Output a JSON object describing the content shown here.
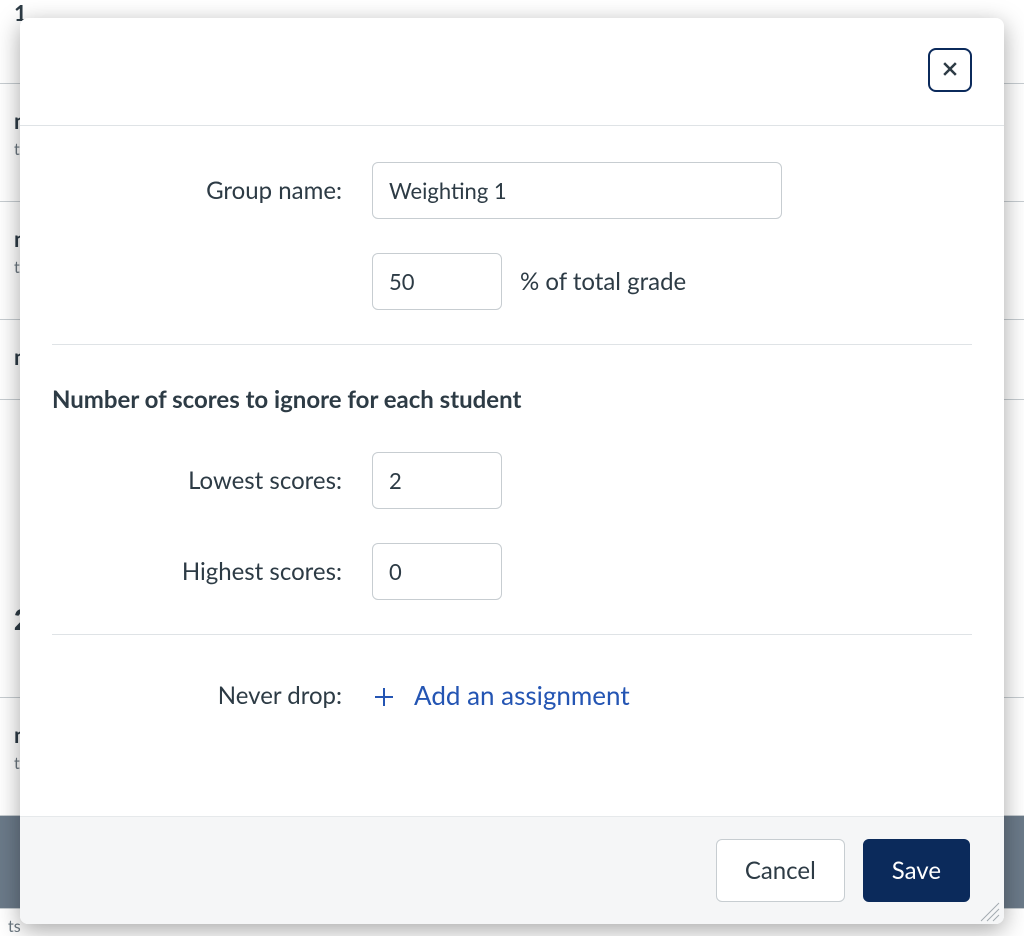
{
  "form": {
    "group_name_label": "Group name:",
    "group_name_value": "Weighting 1",
    "percent_value": "50",
    "percent_suffix": "% of total grade",
    "ignore_section_title": "Number of scores to ignore for each student",
    "lowest_label": "Lowest scores:",
    "lowest_value": "2",
    "highest_label": "Highest scores:",
    "highest_value": "0",
    "never_drop_label": "Never drop:",
    "add_assignment_label": "Add an assignment"
  },
  "footer": {
    "cancel_label": "Cancel",
    "save_label": "Save"
  },
  "background": {
    "heading_partial": "1",
    "item_title_partial": "m",
    "item_sub_partial": "t",
    "big_partial": "2",
    "foot_partial": "ts"
  }
}
